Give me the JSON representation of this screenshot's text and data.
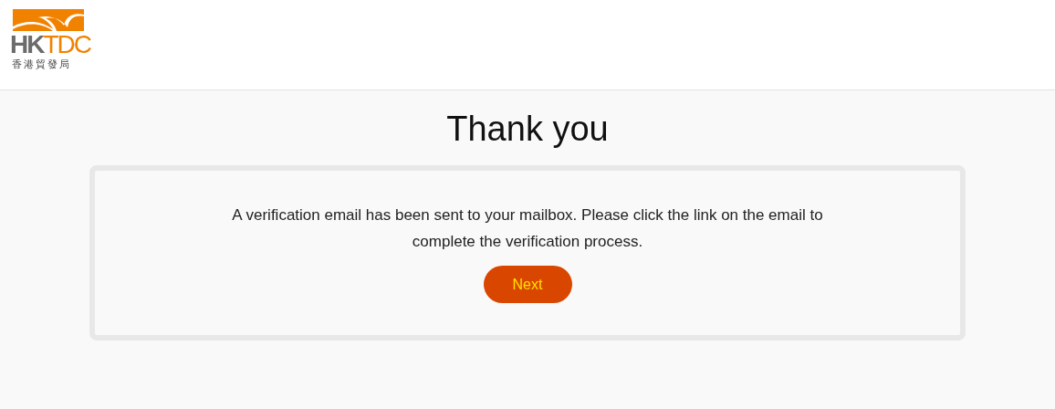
{
  "logo": {
    "letters_grey": "HK",
    "letters_orange": "TDC",
    "chinese": "香港貿發局"
  },
  "title": "Thank you",
  "message": "A verification email has been sent to your mailbox. Please click the link on the email to complete the verification process.",
  "buttons": [
    "Next"
  ]
}
